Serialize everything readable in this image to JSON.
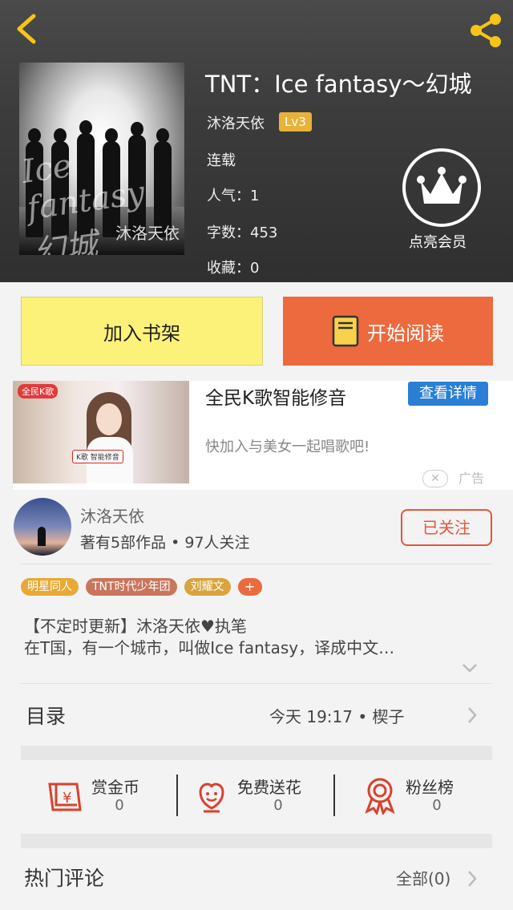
{
  "book": {
    "title": "TNT：Ice fantasy～幻城",
    "author": "沐洛天依",
    "level": "Lv3",
    "status": "连载",
    "popularity": "人气：1",
    "word_count": "字数：453",
    "favorites": "收藏：0",
    "cover": {
      "title_art": "Ice fantasy 幻城",
      "author_art": "沐洛天依"
    },
    "vip_label": "点亮会员"
  },
  "actions": {
    "add_shelf": "加入书架",
    "start_reading": "开始阅读"
  },
  "ad": {
    "headline": "全民K歌智能修音",
    "detail_button": "查看详情",
    "subtitle": "快加入与美女一起唱歌吧!",
    "tag": "广告",
    "image_logo": "全民K歌",
    "image_chip": "K歌 智能修音"
  },
  "author_card": {
    "name": "沐洛天依",
    "stats": "著有5部作品 • 97人关注",
    "follow_button": "已关注"
  },
  "tags": [
    {
      "label": "明星同人",
      "color": "#e8a935"
    },
    {
      "label": "TNT时代少年团",
      "color": "#c9765e"
    },
    {
      "label": "刘耀文",
      "color": "#d9a43e"
    },
    {
      "label": "+",
      "color": "#ec6a3e"
    }
  ],
  "description": {
    "line1": "【不定时更新】沐洛天依♥执笔",
    "line2": "在T国，有一个城市，叫做Ice fantasy，译成中文…"
  },
  "toc": {
    "title": "目录",
    "update": "今天 19:17 • 楔子"
  },
  "rewards": [
    {
      "label": "赏金币",
      "count": "0",
      "icon": "coin-envelope-icon"
    },
    {
      "label": "免费送花",
      "count": "0",
      "icon": "flower-icon"
    },
    {
      "label": "粉丝榜",
      "count": "0",
      "icon": "medal-icon"
    }
  ],
  "comments": {
    "title": "热门评论",
    "all": "全部(0)"
  },
  "colors": {
    "accent": "#ec6a3e",
    "shelf_button": "#fcf27a",
    "ad_button": "#2a7fd4",
    "level_badge": "#e8b23a"
  }
}
